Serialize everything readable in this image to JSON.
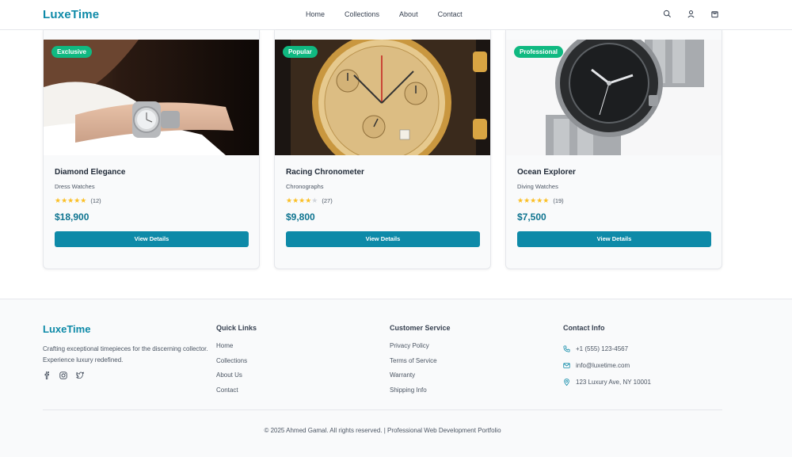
{
  "header": {
    "logo": "LuxeTime",
    "nav": [
      "Home",
      "Collections",
      "About",
      "Contact"
    ],
    "icons": [
      "search-icon",
      "user-icon",
      "cart-icon"
    ]
  },
  "products": [
    {
      "badge": "Exclusive",
      "title": "Diamond Elegance",
      "category": "Dress Watches",
      "rating": 5,
      "reviews": "(12)",
      "price": "$18,900",
      "button": "View Details"
    },
    {
      "badge": "Popular",
      "title": "Racing Chronometer",
      "category": "Chronographs",
      "rating": 4,
      "reviews": "(27)",
      "price": "$9,800",
      "button": "View Details"
    },
    {
      "badge": "Professional",
      "title": "Ocean Explorer",
      "category": "Diving Watches",
      "rating": 5,
      "reviews": "(19)",
      "price": "$7,500",
      "button": "View Details"
    }
  ],
  "footer": {
    "logo": "LuxeTime",
    "description": "Crafting exceptional timepieces for the discerning collector. Experience luxury redefined.",
    "social": [
      "facebook-icon",
      "instagram-icon",
      "twitter-icon"
    ],
    "quick_links": {
      "title": "Quick Links",
      "items": [
        "Home",
        "Collections",
        "About Us",
        "Contact"
      ]
    },
    "customer_service": {
      "title": "Customer Service",
      "items": [
        "Privacy Policy",
        "Terms of Service",
        "Warranty",
        "Shipping Info"
      ]
    },
    "contact": {
      "title": "Contact Info",
      "phone": "+1 (555) 123-4567",
      "email": "info@luxetime.com",
      "address": "123 Luxury Ave, NY 10001"
    },
    "copyright": "© 2025 Ahmed Gamal. All rights reserved. | Professional Web Development Portfolio"
  },
  "colors": {
    "brand": "#0e8aa8",
    "badge": "#10b981",
    "star": "#fbbf24",
    "price": "#0e7490"
  }
}
